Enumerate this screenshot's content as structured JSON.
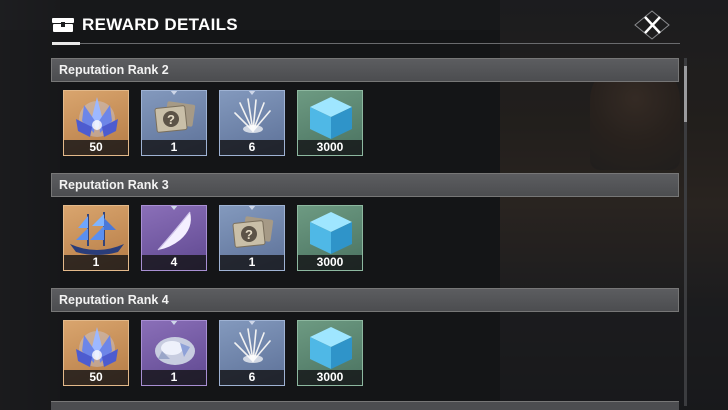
{
  "header": {
    "title": "REWARD DETAILS",
    "icon": "chest-icon",
    "close_icon": "close-icon"
  },
  "sections": [
    {
      "title": "Reputation Rank 2",
      "items": [
        {
          "name": "crystal-lotus-icon",
          "qty": "50",
          "rarity": "orange"
        },
        {
          "name": "mystery-tickets-icon",
          "qty": "1",
          "rarity": "blue"
        },
        {
          "name": "feather-burst-icon",
          "qty": "6",
          "rarity": "blue"
        },
        {
          "name": "blue-cube-icon",
          "qty": "3000",
          "rarity": "green"
        }
      ]
    },
    {
      "title": "Reputation Rank 3",
      "items": [
        {
          "name": "ghost-ship-icon",
          "qty": "1",
          "rarity": "orange"
        },
        {
          "name": "white-feather-icon",
          "qty": "4",
          "rarity": "purple"
        },
        {
          "name": "mystery-tickets-icon",
          "qty": "1",
          "rarity": "blue"
        },
        {
          "name": "blue-cube-icon",
          "qty": "3000",
          "rarity": "green"
        }
      ]
    },
    {
      "title": "Reputation Rank 4",
      "items": [
        {
          "name": "crystal-lotus-icon",
          "qty": "50",
          "rarity": "orange"
        },
        {
          "name": "crystal-ore-icon",
          "qty": "1",
          "rarity": "purple"
        },
        {
          "name": "feather-burst-icon",
          "qty": "6",
          "rarity": "blue"
        },
        {
          "name": "blue-cube-icon",
          "qty": "3000",
          "rarity": "green"
        }
      ]
    }
  ],
  "colors": {
    "orange": "#c98f57",
    "blue": "#6f84ab",
    "purple": "#7559a3",
    "green": "#5b8670"
  }
}
